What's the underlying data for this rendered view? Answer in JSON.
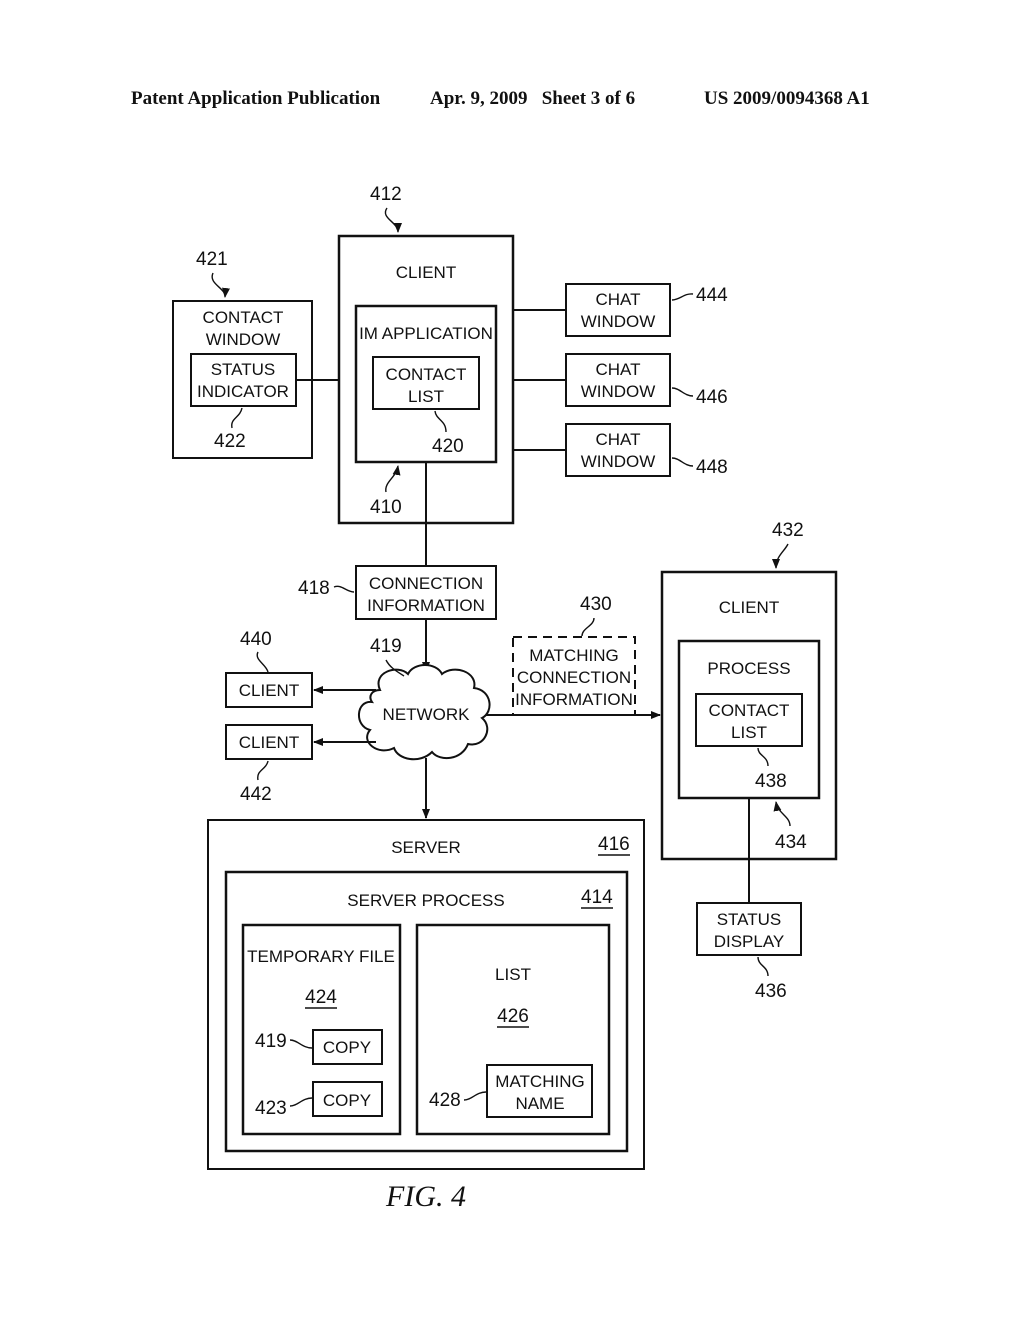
{
  "header": {
    "publication": "Patent Application Publication",
    "date_sheet": "Apr. 9, 2009   Sheet 3 of 6",
    "number": "US 2009/0094368 A1"
  },
  "figure": {
    "caption": "FIG. 4",
    "nodes": {
      "client_412": {
        "label": "CLIENT",
        "ref": "412"
      },
      "im_app_410": {
        "label": "IM APPLICATION",
        "ref": "410"
      },
      "contact_list_420": {
        "line1": "CONTACT",
        "line2": "LIST",
        "ref": "420"
      },
      "contact_window_421": {
        "line1": "CONTACT",
        "line2": "WINDOW",
        "ref": "421"
      },
      "status_indicator_422": {
        "line1": "STATUS",
        "line2": "INDICATOR",
        "ref": "422"
      },
      "chat_444": {
        "line1": "CHAT",
        "line2": "WINDOW",
        "ref": "444"
      },
      "chat_446": {
        "line1": "CHAT",
        "line2": "WINDOW",
        "ref": "446"
      },
      "chat_448": {
        "line1": "CHAT",
        "line2": "WINDOW",
        "ref": "448"
      },
      "conn_info_418": {
        "line1": "CONNECTION",
        "line2": "INFORMATION",
        "ref": "418"
      },
      "network_419": {
        "label": "NETWORK",
        "ref": "419"
      },
      "client_440": {
        "label": "CLIENT",
        "ref": "440"
      },
      "client_442": {
        "label": "CLIENT",
        "ref": "442"
      },
      "matching_430": {
        "line1": "MATCHING",
        "line2": "CONNECTION",
        "line3": "INFORMATION",
        "ref": "430"
      },
      "client_432": {
        "label": "CLIENT",
        "ref": "432"
      },
      "process_434": {
        "label": "PROCESS",
        "ref": "434"
      },
      "contact_list_438": {
        "line1": "CONTACT",
        "line2": "LIST",
        "ref": "438"
      },
      "status_display_436": {
        "line1": "STATUS",
        "line2": "DISPLAY",
        "ref": "436"
      },
      "server_416": {
        "label": "SERVER",
        "ref": "416"
      },
      "server_process_414": {
        "label": "SERVER PROCESS",
        "ref": "414"
      },
      "temp_file_424": {
        "label": "TEMPORARY FILE",
        "ref": "424"
      },
      "copy_419": {
        "label": "COPY",
        "ref": "419"
      },
      "copy_423": {
        "label": "COPY",
        "ref": "423"
      },
      "list_426": {
        "label": "LIST",
        "ref": "426"
      },
      "matching_name_428": {
        "line1": "MATCHING",
        "line2": "NAME",
        "ref": "428"
      }
    }
  }
}
